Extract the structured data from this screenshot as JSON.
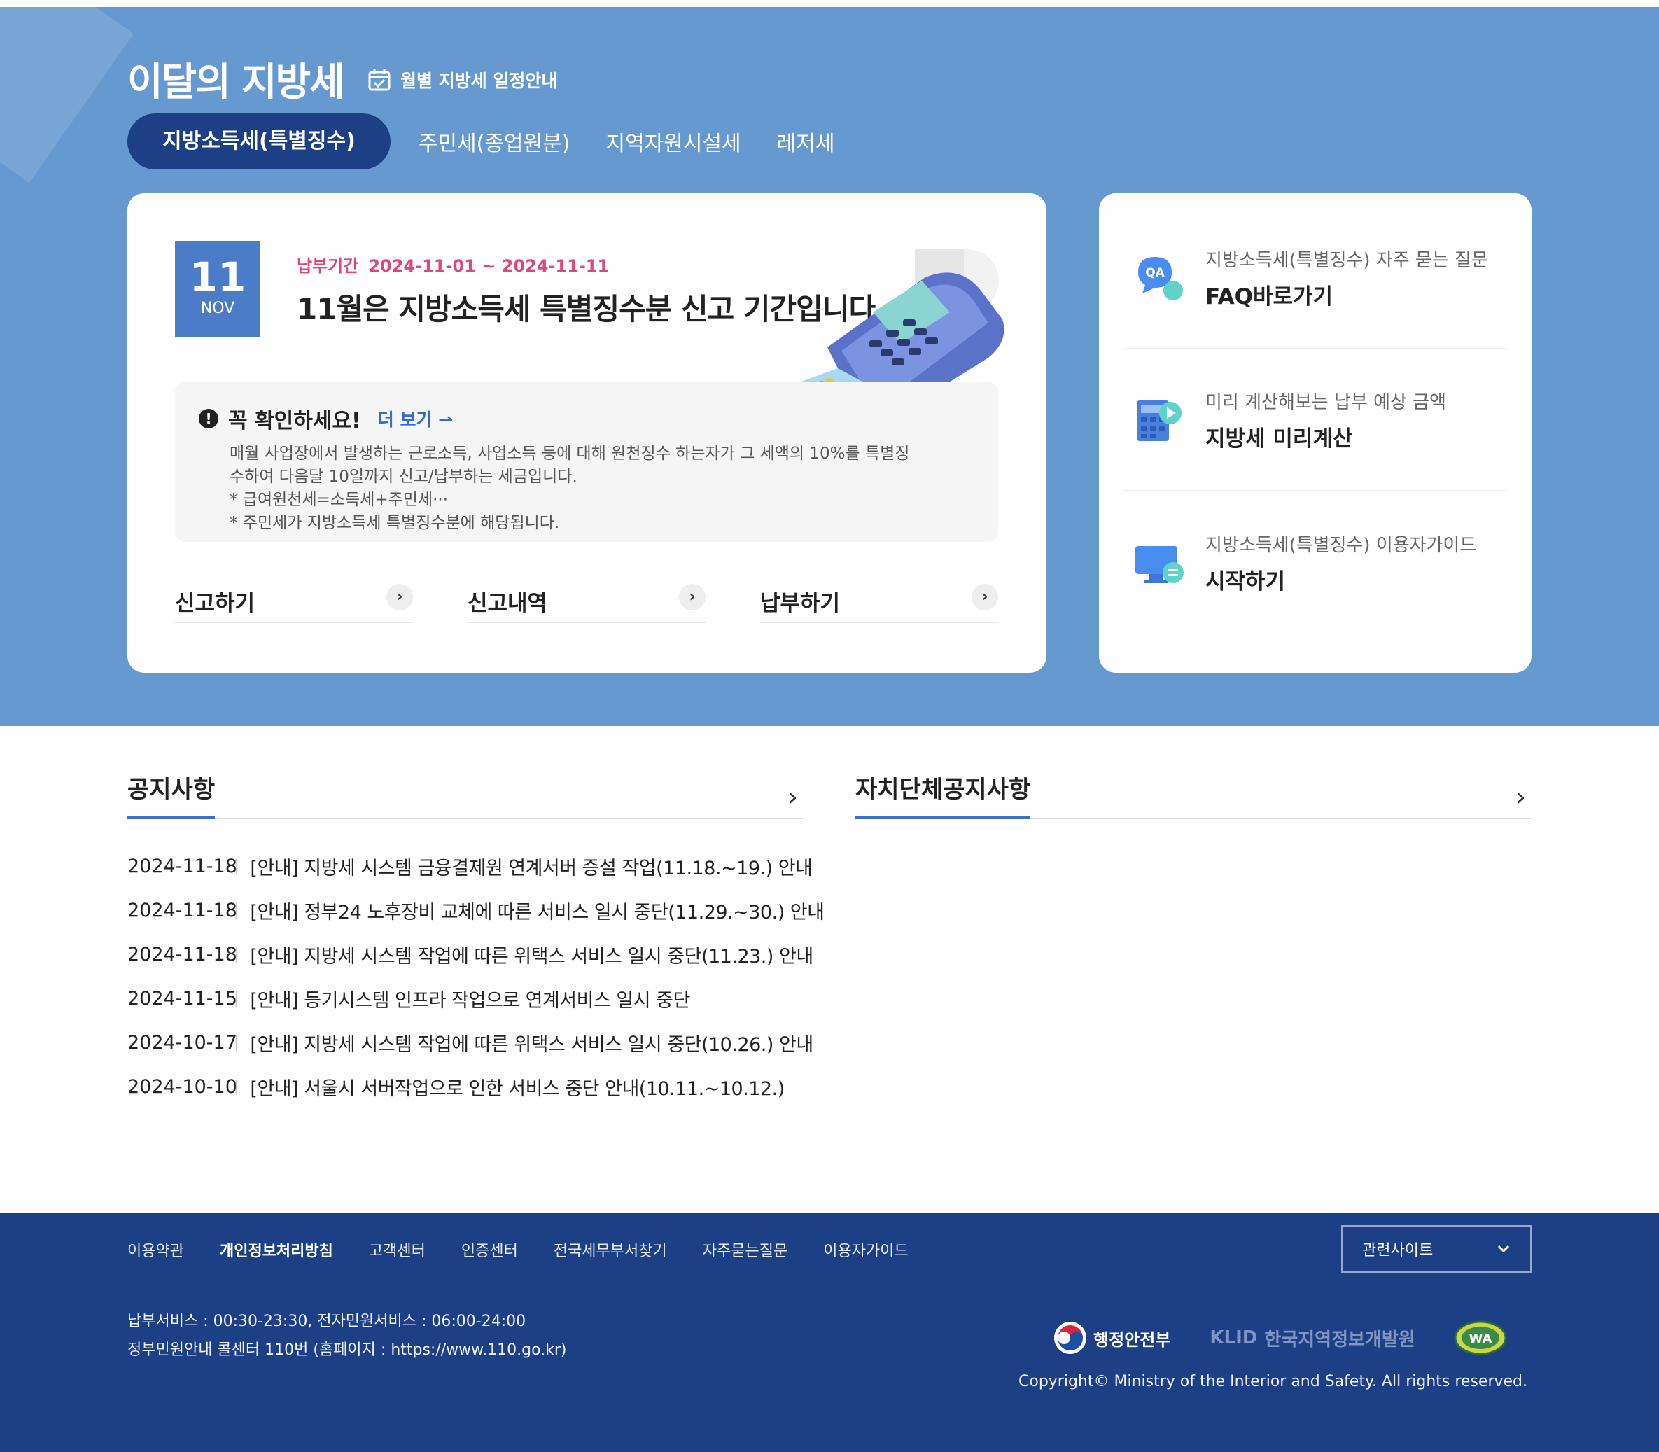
{
  "header": {
    "title": "이달의 지방세",
    "schedule_link": "월별 지방세 일정안내"
  },
  "tabs": [
    {
      "label": "지방소득세(특별징수)",
      "active": true
    },
    {
      "label": "주민세(종업원분)",
      "active": false
    },
    {
      "label": "지역자원시설세",
      "active": false
    },
    {
      "label": "레저세",
      "active": false
    }
  ],
  "main_card": {
    "date_day": "11",
    "date_month": "NOV",
    "period_label": "납부기간",
    "period_value": "2024-11-01 ~ 2024-11-11",
    "headline": "11월은 지방소득세 특별징수분 신고 기간입니다.",
    "notice_title": "꼭 확인하세요!",
    "more_label": "더 보기",
    "notice_lines": [
      "매월 사업장에서 발생하는 근로소득, 사업소득 등에 대해 원천징수 하는자가 그 세액의 10%를 특별징",
      "수하여 다음달 10일까지 신고/납부하는 세금입니다.",
      "* 급여원천세=소득세+주민세···",
      "* 주민세가 지방소득세 특별징수분에 해당됩니다."
    ],
    "actions": [
      "신고하기",
      "신고내역",
      "납부하기"
    ]
  },
  "side_card": [
    {
      "sub": "지방소득세(특별징수) 자주 묻는 질문",
      "main": "FAQ바로가기",
      "icon": "qa-icon"
    },
    {
      "sub": "미리 계산해보는 납부 예상 금액",
      "main": "지방세 미리계산",
      "icon": "calculator-icon"
    },
    {
      "sub": "지방소득세(특별징수) 이용자가이드",
      "main": "시작하기",
      "icon": "monitor-guide-icon"
    }
  ],
  "notices": {
    "title": "공지사항",
    "items": [
      {
        "date": "2024-11-18",
        "text": "[안내] 지방세 시스템 금융결제원 연계서버 증설 작업(11.18.~19.) 안내"
      },
      {
        "date": "2024-11-18",
        "text": "[안내] 정부24 노후장비 교체에 따른 서비스 일시 중단(11.29.~30.) 안내"
      },
      {
        "date": "2024-11-18",
        "text": "[안내] 지방세 시스템 작업에 따른 위택스 서비스 일시 중단(11.23.) 안내"
      },
      {
        "date": "2024-11-15",
        "text": "[안내] 등기시스템 인프라 작업으로 연계서비스 일시 중단"
      },
      {
        "date": "2024-10-17",
        "text": "[안내] 지방세 시스템 작업에 따른 위택스 서비스 일시 중단(10.26.) 안내"
      },
      {
        "date": "2024-10-10",
        "text": "[안내] 서울시 서버작업으로 인한 서비스 중단 안내(10.11.~10.12.)"
      }
    ]
  },
  "local_notices": {
    "title": "자치단체공지사항"
  },
  "footer": {
    "links": [
      "이용약관",
      "개인정보처리방침",
      "고객센터",
      "인증센터",
      "전국세무부서찾기",
      "자주묻는질문",
      "이용자가이드"
    ],
    "related_label": "관련사이트",
    "info_line1": "납부서비스 : 00:30-23:30, 전자민원서비스 : 06:00-24:00",
    "info_line2": "정부민원안내 콜센터 110번 (홈페이지 : https://www.110.go.kr)",
    "logo_mois": "행정안전부",
    "logo_klid_mark": "KLID",
    "logo_klid": "한국지역정보개발원",
    "logo_wa": "WA",
    "copyright": "Copyright© Ministry of the Interior and Safety. All rights reserved."
  },
  "colors": {
    "hero_bg": "#6699cf",
    "active_tab": "#1d3f86",
    "accent_pink": "#e0457b",
    "link_blue": "#2f6ad8",
    "footer_bg": "#1d3f86"
  }
}
